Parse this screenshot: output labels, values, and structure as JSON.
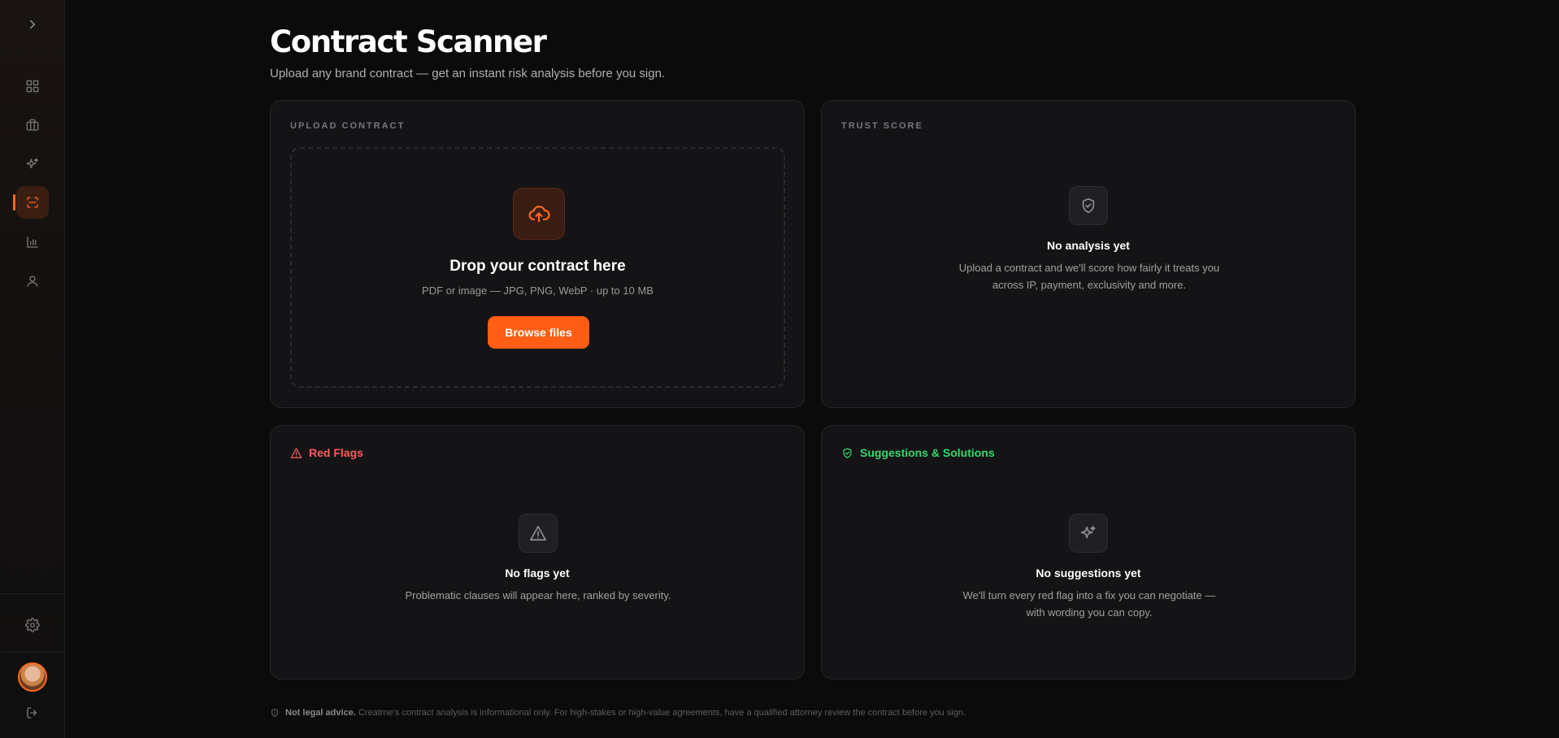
{
  "sidebar": {
    "icons": [
      "chevron-right-icon",
      "dashboard-icon",
      "briefcase-icon",
      "sparkles-icon",
      "scan-icon",
      "bar-chart-icon",
      "user-icon",
      "gear-icon",
      "logout-icon"
    ],
    "active_item": "scan-icon"
  },
  "page": {
    "title": "Contract Scanner",
    "subtitle": "Upload any brand contract — get an instant risk analysis before you sign."
  },
  "upload": {
    "label": "UPLOAD CONTRACT",
    "title": "Drop your contract here",
    "subtitle": "PDF or image — JPG, PNG, WebP · up to 10 MB",
    "button": "Browse files"
  },
  "trust": {
    "label": "TRUST SCORE",
    "empty_title": "No analysis yet",
    "empty_desc": "Upload a contract and we'll score how fairly it treats you across IP, payment, exclusivity and more."
  },
  "red_flags": {
    "label": "Red Flags",
    "empty_title": "No flags yet",
    "empty_desc": "Problematic clauses will appear here, ranked by severity."
  },
  "suggestions": {
    "label": "Suggestions & Solutions",
    "empty_title": "No suggestions yet",
    "empty_desc": "We'll turn every red flag into a fix you can negotiate — with wording you can copy."
  },
  "disclaimer": {
    "bold": "Not legal advice.",
    "text": "Creatrne's contract analysis is informational only. For high-stakes or high-value agreements, have a qualified attorney review the contract before you sign."
  },
  "colors": {
    "accent": "#ff5e14",
    "danger": "#ff5c5c",
    "success": "#39d66e",
    "background": "#0b0b0c",
    "card": "#141416"
  }
}
